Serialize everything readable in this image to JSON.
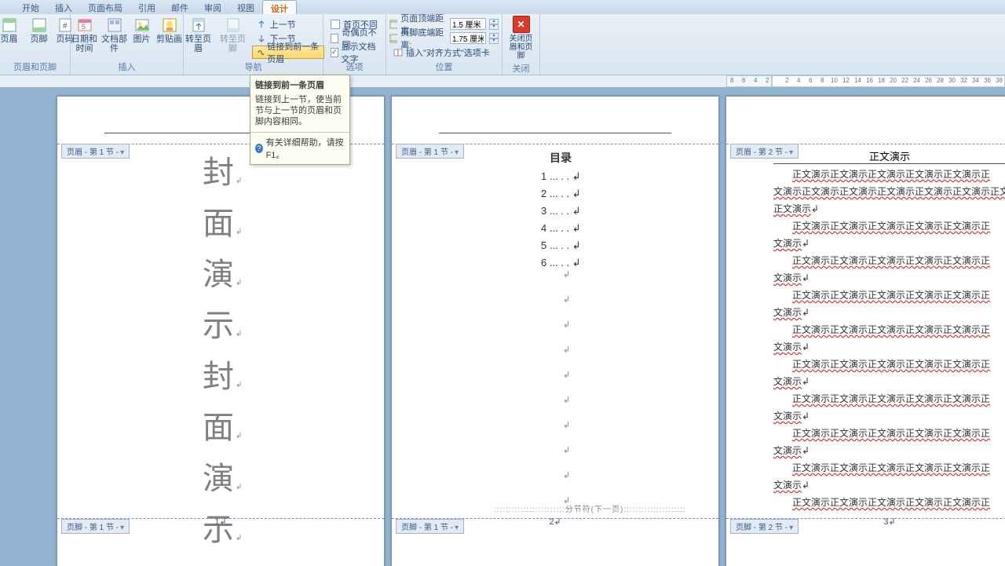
{
  "tabs": [
    "开始",
    "插入",
    "页面布局",
    "引用",
    "邮件",
    "审阅",
    "视图",
    "设计"
  ],
  "active_tab": "设计",
  "groups": {
    "hf": {
      "label": "页眉和页脚",
      "items": [
        "页眉",
        "页脚",
        "页码"
      ]
    },
    "insert": {
      "label": "插入",
      "items": [
        "日期和时间",
        "文档部件",
        "图片",
        "剪贴画"
      ]
    },
    "nav": {
      "label": "导航",
      "goto_hdr": "转至页眉",
      "goto_ftr": "转至页脚",
      "prev": "上一节",
      "next": "下一节",
      "link": "链接到前一条页眉"
    },
    "options": {
      "label": "选项",
      "first": "首页不同",
      "oddeven": "奇偶页不同",
      "showtext": "显示文档文字"
    },
    "position": {
      "label": "位置",
      "top": "页面顶端距离:",
      "top_v": "1.5 厘米",
      "bot": "页脚底端距离:",
      "bot_v": "1.75 厘米",
      "align": "插入\"对齐方式\"选项卡"
    },
    "close": {
      "label": "关闭",
      "btn": "关闭页眉和页脚"
    }
  },
  "tooltip": {
    "title": "链接到前一条页眉",
    "body": "链接到上一节，使当前节与上一节的页眉和页脚内容相同。",
    "foot": "有关详细帮助，请按 F1。"
  },
  "page1": {
    "hdr_tag": "页眉 - 第 1 节 -",
    "ftr_tag": "页脚 - 第 1 节 -",
    "cover": [
      "封",
      "面",
      "演",
      "示",
      "封",
      "面",
      "演",
      "示"
    ],
    "pagenum": "1"
  },
  "page2": {
    "hdr_tag": "页眉 - 第 1 节 -",
    "ftr_tag": "页脚 - 第 1 节 -",
    "toc_title": "目录",
    "toc": [
      "1 ... . .",
      "2 ... . .",
      "3 ... . .",
      "4 ... . .",
      "5 ... . .",
      "6 ... . ."
    ],
    "section_break": "分节符(下一页)",
    "pagenum": "2"
  },
  "page3": {
    "hdr_tag": "页眉 - 第 2 节 -",
    "ftr_tag": "页脚 - 第 2 节 -",
    "title": "正文演示",
    "line_long": "正文演示正文演示正文演示正文演示正文演示正",
    "line_wrap": "文演示正文演示正文演示正文演示正文演示正文演示正文演示",
    "line_short1": "正文演示",
    "line_med": "正文演示正文演示正文演示正文演示正文演示正",
    "line_short2": "文演示",
    "pagenum": "3"
  },
  "ruler_ticks": [
    8,
    6,
    4,
    2,
    2,
    4,
    6,
    8,
    10,
    12,
    14,
    16,
    18,
    20,
    22,
    24,
    26,
    28,
    30,
    32,
    34,
    36,
    38
  ]
}
